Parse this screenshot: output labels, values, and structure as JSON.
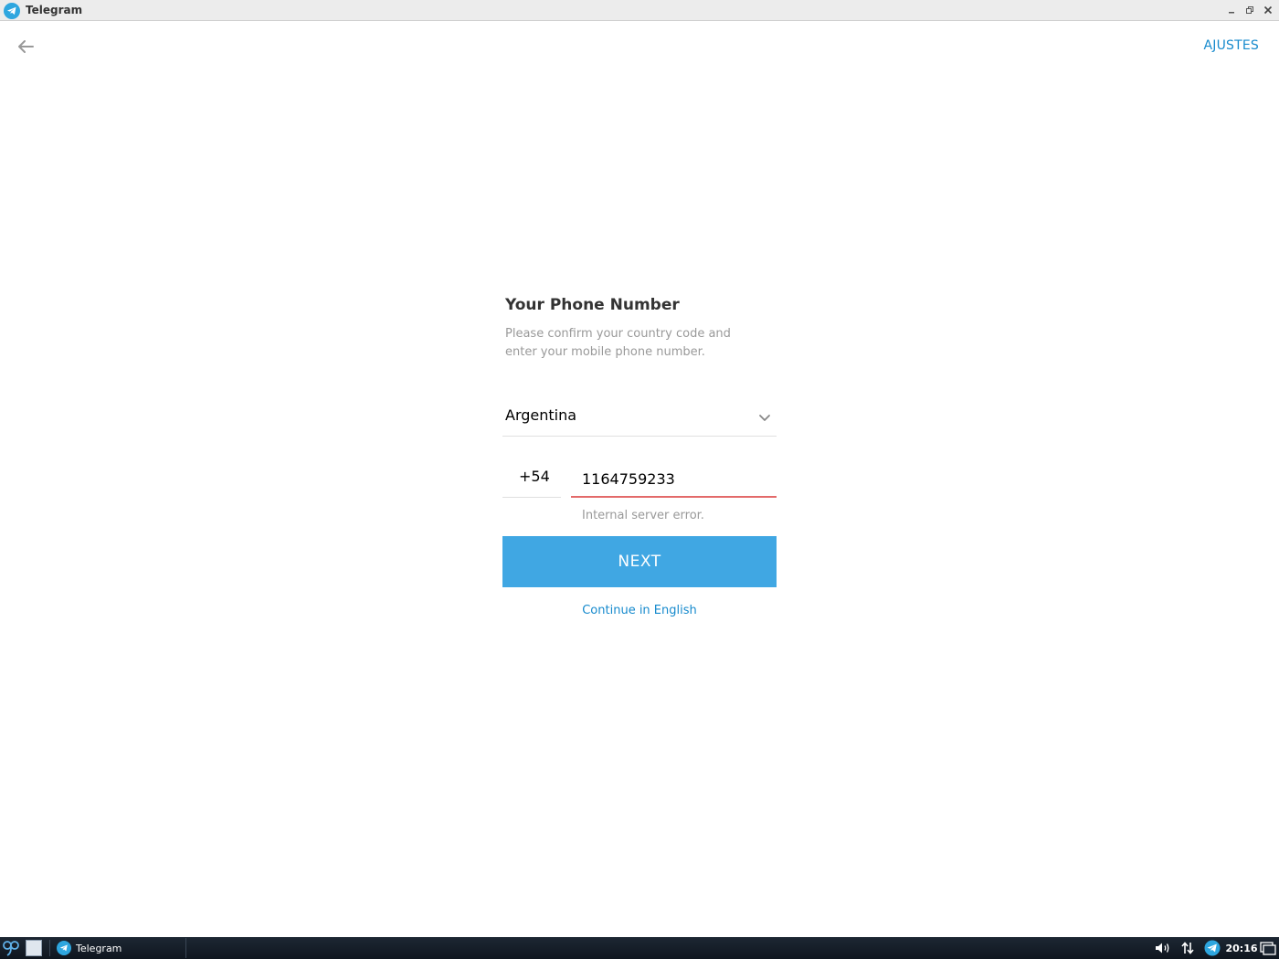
{
  "window": {
    "title": "Telegram",
    "icon": "telegram-icon"
  },
  "header": {
    "back_icon": "arrow-left-icon",
    "settings_label": "AJUSTES"
  },
  "login": {
    "heading": "Your Phone Number",
    "description": "Please confirm your country code and enter your mobile phone number.",
    "country": "Argentina",
    "country_code": "+54",
    "phone_value": "1164759233",
    "error": "Internal server error.",
    "next_label": "NEXT",
    "language_link": "Continue in English"
  },
  "taskbar": {
    "task_label": "Telegram",
    "clock": "20:16"
  },
  "colors": {
    "accent": "#40a7e3",
    "link": "#168acd",
    "error_underline": "#e36a6a"
  }
}
